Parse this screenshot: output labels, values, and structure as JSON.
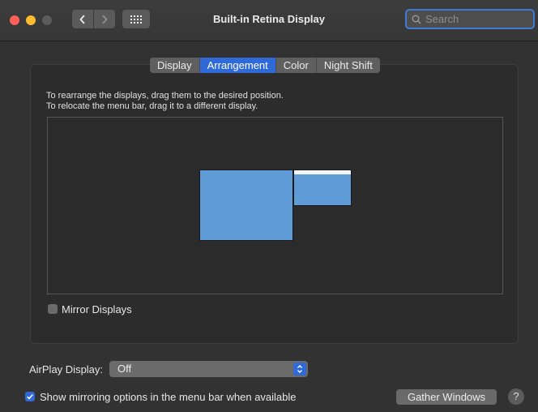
{
  "window": {
    "title": "Built-in Retina Display",
    "search_placeholder": "Search"
  },
  "tabs": [
    {
      "label": "Display",
      "active": false
    },
    {
      "label": "Arrangement",
      "active": true
    },
    {
      "label": "Color",
      "active": false
    },
    {
      "label": "Night Shift",
      "active": false
    }
  ],
  "arrangement": {
    "instruction_line1": "To rearrange the displays, drag them to the desired position.",
    "instruction_line2": "To relocate the menu bar, drag it to a different display.",
    "mirror_label": "Mirror Displays",
    "mirror_checked": false
  },
  "airplay": {
    "label": "AirPlay Display:",
    "value": "Off"
  },
  "show_mirroring": {
    "label": "Show mirroring options in the menu bar when available",
    "checked": true
  },
  "buttons": {
    "gather": "Gather Windows",
    "help": "?"
  },
  "colors": {
    "accent": "#2f6ad8",
    "display_fill": "#5f9bd6"
  }
}
